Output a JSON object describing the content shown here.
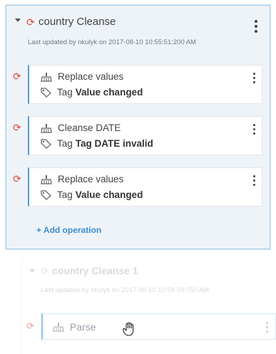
{
  "step": {
    "title": "country Cleanse",
    "meta": "Last updated by nkulyk on 2017-08-10 10:55:51:200 AM",
    "operations": [
      {
        "name": "Replace values",
        "tag_prefix": "Tag",
        "tag_value": "Value changed"
      },
      {
        "name": "Cleanse DATE",
        "tag_prefix": "Tag",
        "tag_value": "Tag DATE invalid"
      },
      {
        "name": "Replace values",
        "tag_prefix": "Tag",
        "tag_value": "Value changed"
      }
    ],
    "add_operation": "+ Add operation"
  },
  "ghost_step": {
    "title": "country Cleanse 1",
    "meta": "Last updated by nkulyk on 2017-08-10 10:58:59:750 AM",
    "operation": "Parse"
  },
  "colors": {
    "accent": "#4a9fd9",
    "sync": "#e0483e",
    "link": "#3b8fd1"
  }
}
